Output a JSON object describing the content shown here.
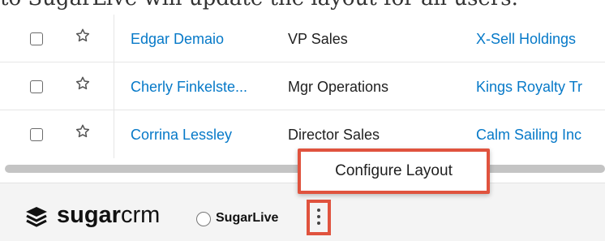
{
  "doc_text": "to SugarLive will update the layout for all users.",
  "rows": [
    {
      "name": "Edgar Demaio",
      "title": "VP Sales",
      "account": "X-Sell Holdings"
    },
    {
      "name": "Cherly Finkelste...",
      "title": "Mgr Operations",
      "account": "Kings Royalty Tr"
    },
    {
      "name": "Corrina Lessley",
      "title": "Director Sales",
      "account": "Calm Sailing Inc"
    }
  ],
  "footer": {
    "logo_bold": "sugar",
    "logo_light": "crm",
    "sugarlive_label": "SugarLive"
  },
  "menu": {
    "configure_layout": "Configure Layout"
  },
  "colors": {
    "link": "#0679c8",
    "highlight": "#e0533e"
  }
}
